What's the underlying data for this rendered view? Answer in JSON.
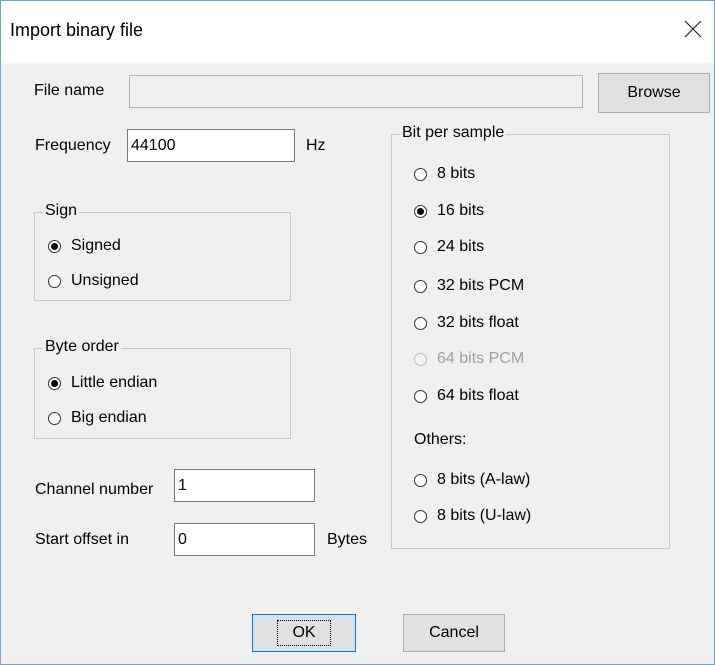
{
  "window": {
    "title": "Import binary file"
  },
  "file": {
    "label": "File name",
    "value": "",
    "browse_label": "Browse"
  },
  "frequency": {
    "label": "Frequency",
    "value": "44100",
    "unit": "Hz"
  },
  "sign": {
    "legend": "Sign",
    "options": [
      {
        "label": "Signed",
        "checked": true
      },
      {
        "label": "Unsigned",
        "checked": false
      }
    ]
  },
  "byte_order": {
    "legend": "Byte order",
    "options": [
      {
        "label": "Little endian",
        "checked": true
      },
      {
        "label": "Big endian",
        "checked": false
      }
    ]
  },
  "channel": {
    "label": "Channel number",
    "value": "1"
  },
  "offset": {
    "label": "Start offset in",
    "value": "0",
    "unit": "Bytes"
  },
  "bits": {
    "legend": "Bit per sample",
    "options": [
      {
        "label": "8 bits",
        "checked": false,
        "enabled": true
      },
      {
        "label": "16 bits",
        "checked": true,
        "enabled": true
      },
      {
        "label": "24 bits",
        "checked": false,
        "enabled": true
      },
      {
        "label": "32 bits PCM",
        "checked": false,
        "enabled": true
      },
      {
        "label": "32 bits float",
        "checked": false,
        "enabled": true
      },
      {
        "label": "64 bits PCM",
        "checked": false,
        "enabled": false
      },
      {
        "label": "64 bits float",
        "checked": false,
        "enabled": true
      }
    ],
    "others_label": "Others:",
    "others": [
      {
        "label": "8 bits (A-law)",
        "checked": false,
        "enabled": true
      },
      {
        "label": "8 bits (U-law)",
        "checked": false,
        "enabled": true
      }
    ]
  },
  "buttons": {
    "ok": "OK",
    "cancel": "Cancel"
  }
}
